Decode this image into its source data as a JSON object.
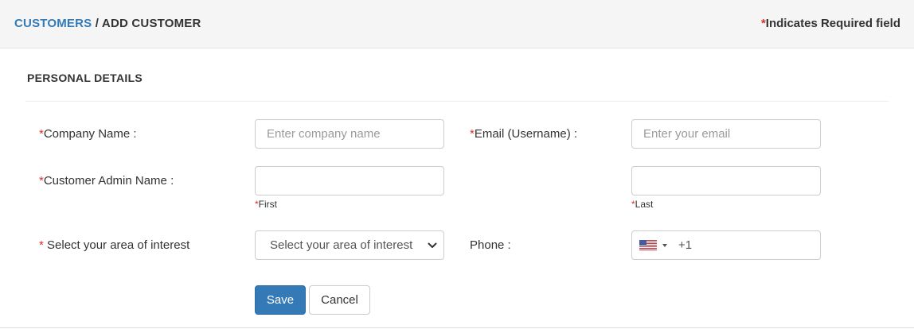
{
  "header": {
    "breadcrumb_link": "CUSTOMERS",
    "breadcrumb_separator": " / ",
    "breadcrumb_current": "ADD CUSTOMER",
    "required_asterisk": "*",
    "required_note": "Indicates Required field"
  },
  "section": {
    "title": "PERSONAL DETAILS"
  },
  "form": {
    "asterisk": "*",
    "company_name": {
      "label": "Company Name :",
      "placeholder": "Enter company name",
      "value": ""
    },
    "email": {
      "label": "Email (Username) :",
      "placeholder": "Enter your email",
      "value": ""
    },
    "admin_name": {
      "label": "Customer Admin Name :",
      "first_hint": "First",
      "last_hint": "Last",
      "first_value": "",
      "last_value": ""
    },
    "interest": {
      "label": " Select your area of interest",
      "selected": "Select your area of interest",
      "icon": "chevron-down-icon"
    },
    "phone": {
      "label": "Phone :",
      "country_flag": "us-flag-icon",
      "dial_code": "+1"
    }
  },
  "actions": {
    "save_label": "Save",
    "cancel_label": "Cancel"
  },
  "colors": {
    "primary": "#337ab7",
    "required": "#d9302c",
    "header_bg": "#f5f5f5"
  }
}
